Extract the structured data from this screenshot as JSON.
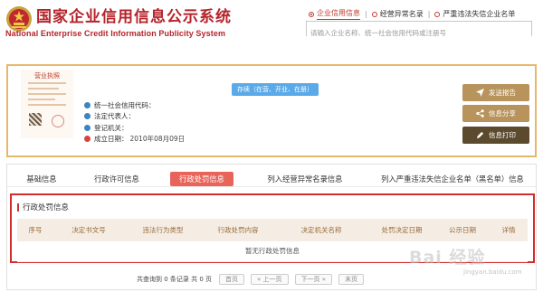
{
  "header": {
    "title": "国家企业信用信息公示系统",
    "subtitle": "National Enterprise Credit Information Publicity System",
    "search_tabs": [
      {
        "label": "企业信用信息",
        "active": true
      },
      {
        "label": "经营异常名录",
        "active": false
      },
      {
        "label": "严重违法失信企业名单",
        "active": false
      }
    ],
    "search_placeholder": "请输入企业名称、统一社会信用代码或注册号",
    "brand_color": "#b5242b"
  },
  "company": {
    "license_label": "营业执照",
    "status": "存续（在营、开业、在册）",
    "status_color": "#5aa9e8",
    "fields": [
      {
        "label": "统一社会信用代码：",
        "value": "",
        "icon": "blue"
      },
      {
        "label": "法定代表人：",
        "value": "",
        "icon": "blue"
      },
      {
        "label": "登记机关：",
        "value": "",
        "icon": "blue"
      },
      {
        "label": "成立日期：",
        "value": "2010年08月09日",
        "icon": "red"
      }
    ],
    "actions": [
      {
        "label": "发送报告",
        "icon": "send-icon"
      },
      {
        "label": "信息分享",
        "icon": "share-icon"
      },
      {
        "label": "信息打印",
        "icon": "print-icon"
      }
    ]
  },
  "tabs": [
    {
      "label": "基础信息",
      "active": false
    },
    {
      "label": "行政许可信息",
      "active": false
    },
    {
      "label": "行政处罚信息",
      "active": true
    },
    {
      "label": "列入经营异常名录信息",
      "active": false
    },
    {
      "label": "列入严重违法失信企业名单（黑名单）信息",
      "active": false
    }
  ],
  "penalty_section": {
    "title": "行政处罚信息",
    "columns": [
      "序号",
      "决定书文号",
      "违法行为类型",
      "行政处罚内容",
      "决定机关名称",
      "处罚决定日期",
      "公示日期",
      "详情"
    ],
    "empty_text": "暂无行政处罚信息"
  },
  "pagination": {
    "summary": "共查询到 0 条记录 共 0 页",
    "first": "首页",
    "prev": "« 上一页",
    "next": "下一页 »",
    "last": "末页"
  },
  "watermark": {
    "text": "Bai 经验",
    "sub": "jingyan.baidu.com"
  }
}
